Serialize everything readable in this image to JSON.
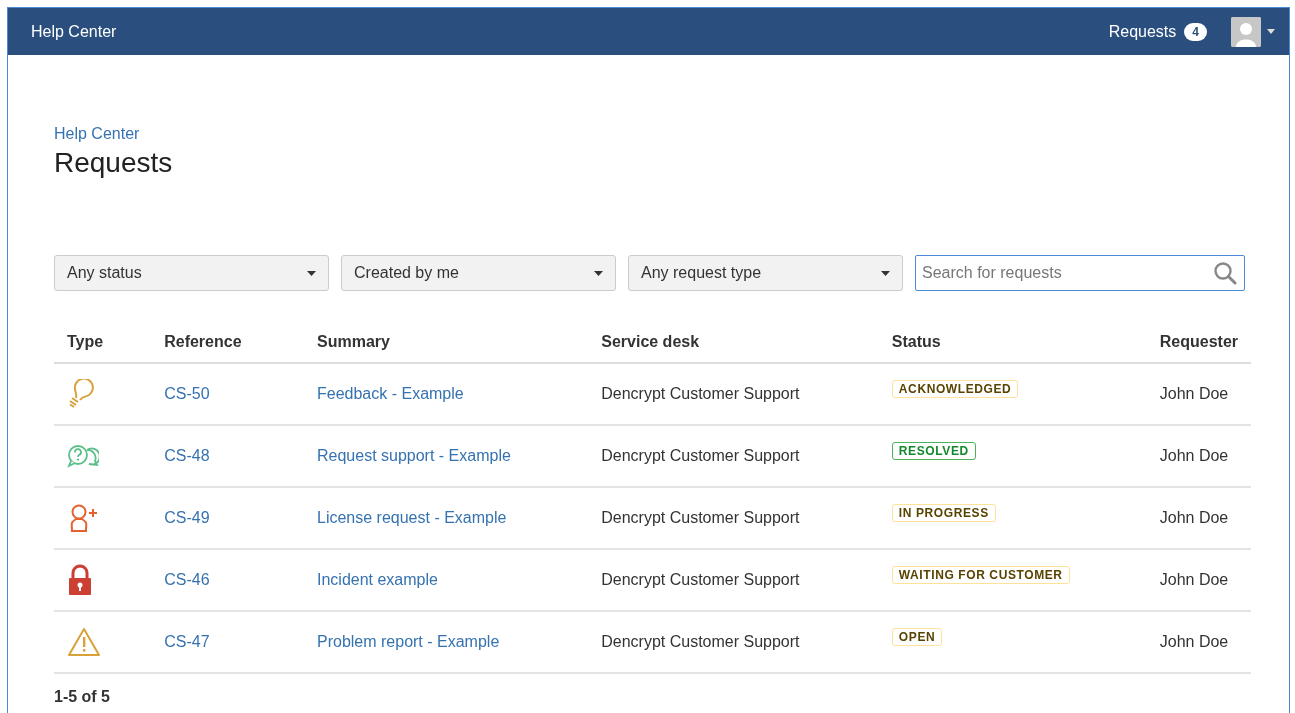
{
  "header": {
    "title": "Help Center",
    "requests_label": "Requests",
    "requests_count": "4"
  },
  "breadcrumb": "Help Center",
  "title": "Requests",
  "filters": [
    {
      "value": "Any status"
    },
    {
      "value": "Created by me"
    },
    {
      "value": "Any request type"
    }
  ],
  "search": {
    "placeholder": "Search for requests"
  },
  "table": {
    "columns": [
      "Type",
      "Reference",
      "Summary",
      "Service desk",
      "Status",
      "Requester"
    ],
    "rows": [
      {
        "kind": "idea",
        "reference": "CS-50",
        "summary": "Feedback - Example",
        "service_desk": "Dencrypt Customer Support",
        "status": {
          "label": "ACKNOWLEDGED",
          "kind": "current"
        },
        "requester": "John Doe"
      },
      {
        "kind": "question",
        "reference": "CS-48",
        "summary": "Request support - Example",
        "service_desk": "Dencrypt Customer Support",
        "status": {
          "label": "RESOLVED",
          "kind": "success"
        },
        "requester": "John Doe"
      },
      {
        "kind": "access",
        "reference": "CS-49",
        "summary": "License request - Example",
        "service_desk": "Dencrypt Customer Support",
        "status": {
          "label": "IN PROGRESS",
          "kind": "current"
        },
        "requester": "John Doe"
      },
      {
        "kind": "incident",
        "reference": "CS-46",
        "summary": "Incident example",
        "service_desk": "Dencrypt Customer Support",
        "status": {
          "label": "WAITING FOR CUSTOMER",
          "kind": "current"
        },
        "requester": "John Doe"
      },
      {
        "kind": "problem",
        "reference": "CS-47",
        "summary": "Problem report - Example",
        "service_desk": "Dencrypt Customer Support",
        "status": {
          "label": "OPEN",
          "kind": "current"
        },
        "requester": "John Doe"
      }
    ]
  },
  "pagination": "1-5 of 5"
}
